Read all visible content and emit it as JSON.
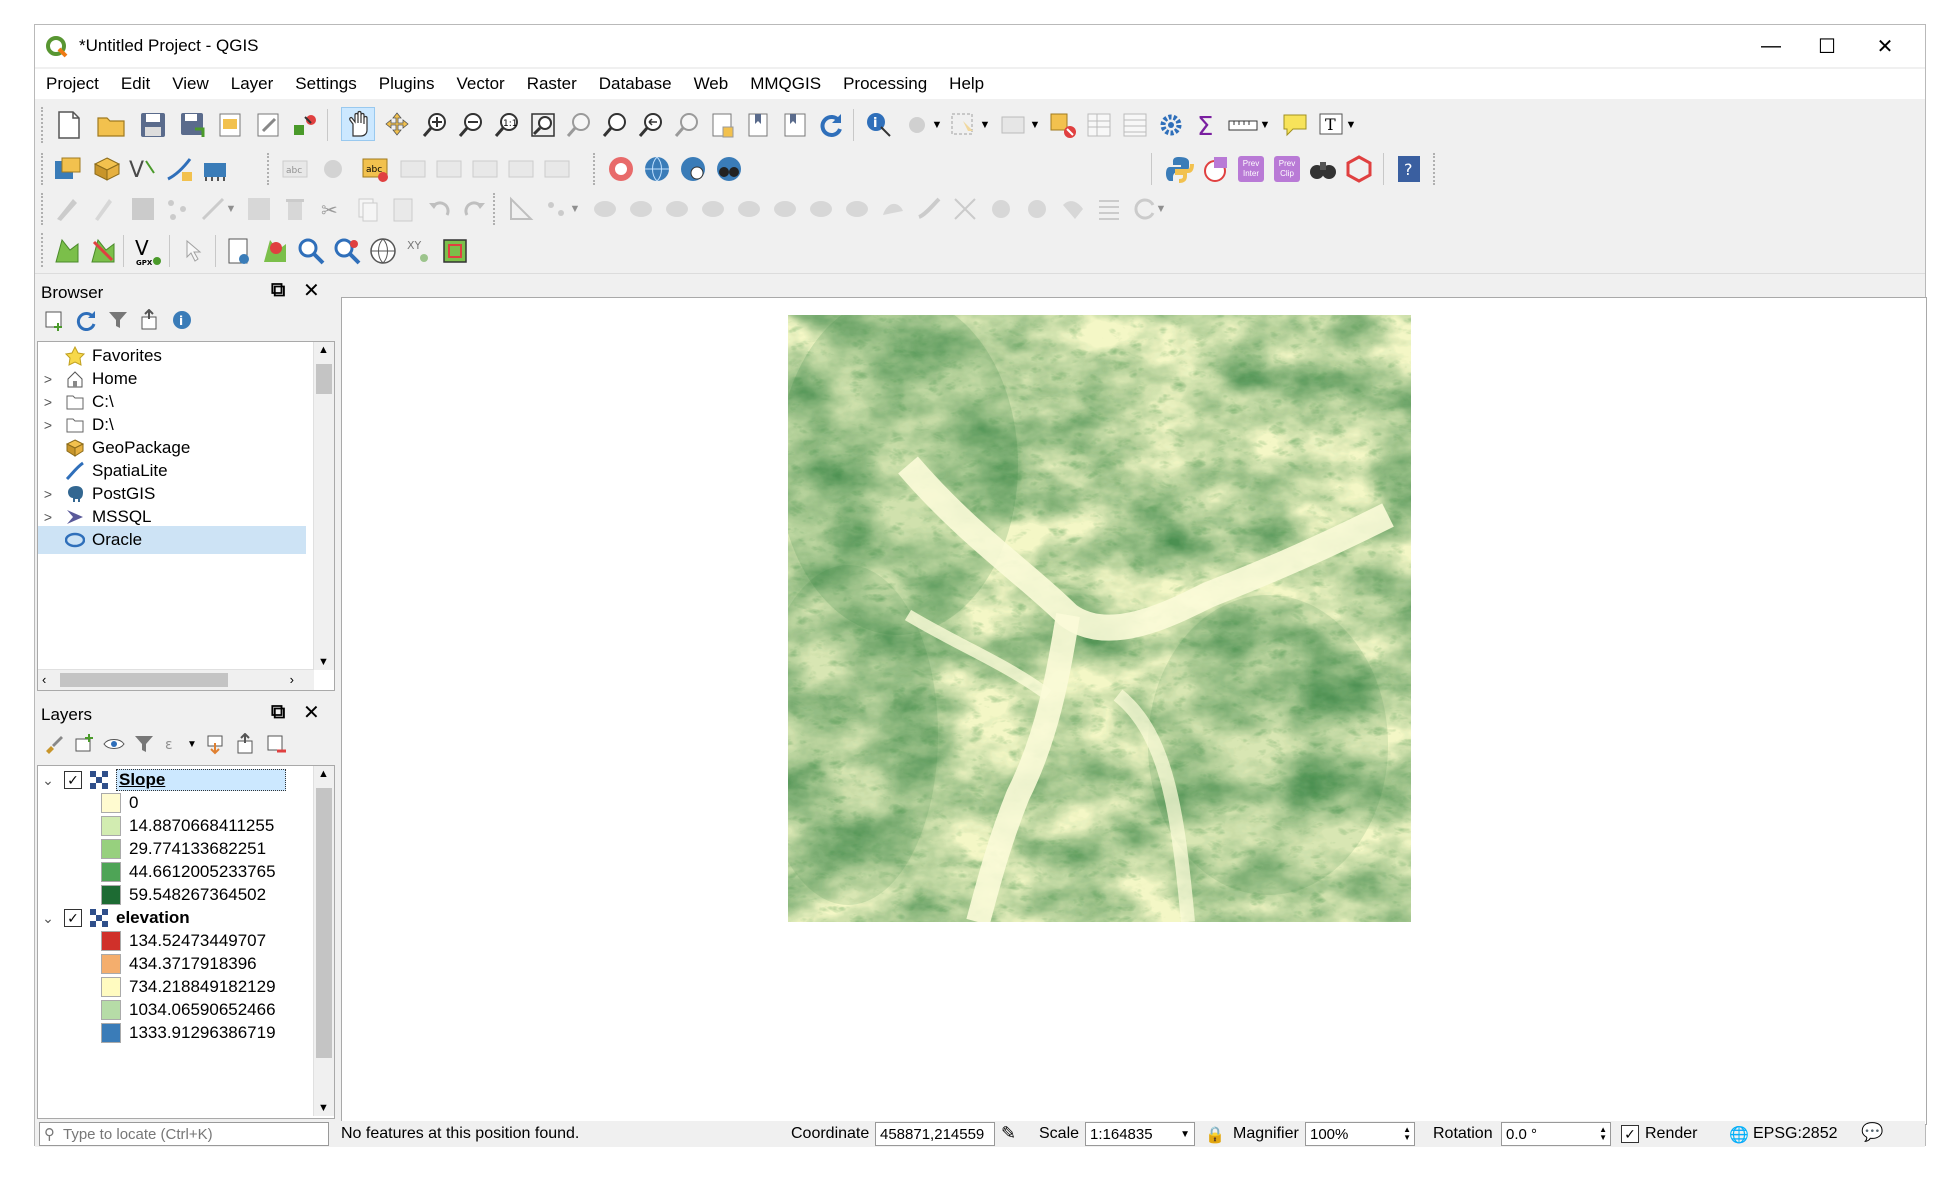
{
  "window": {
    "title": "*Untitled Project - QGIS",
    "controls": {
      "minimize": "—",
      "maximize": "☐",
      "close": "✕"
    }
  },
  "menubar": [
    "Project",
    "Edit",
    "View",
    "Layer",
    "Settings",
    "Plugins",
    "Vector",
    "Raster",
    "Database",
    "Web",
    "MMQGIS",
    "Processing",
    "Help"
  ],
  "toolbar_labels": {
    "prev_inter": "Prev Inter",
    "prev_clip": "Prev Clip",
    "gpx": "GPX"
  },
  "browser": {
    "title": "Browser",
    "items": [
      {
        "label": "Favorites",
        "icon": "star-icon",
        "expand": ""
      },
      {
        "label": "Home",
        "icon": "home-icon",
        "expand": ">"
      },
      {
        "label": "C:\\",
        "icon": "folder-icon",
        "expand": ">"
      },
      {
        "label": "D:\\",
        "icon": "folder-icon",
        "expand": ">"
      },
      {
        "label": "GeoPackage",
        "icon": "geopackage-icon",
        "expand": ""
      },
      {
        "label": "SpatiaLite",
        "icon": "feather-icon",
        "expand": ""
      },
      {
        "label": "PostGIS",
        "icon": "elephant-icon",
        "expand": ">"
      },
      {
        "label": "MSSQL",
        "icon": "mssql-icon",
        "expand": ">"
      },
      {
        "label": "Oracle",
        "icon": "database-icon",
        "expand": ""
      }
    ]
  },
  "layers": {
    "title": "Layers",
    "groups": [
      {
        "name": "Slope",
        "checked": true,
        "legend": [
          {
            "label": "0",
            "color": "#fffbd0"
          },
          {
            "label": "14.8870668411255",
            "color": "#d2ecb1"
          },
          {
            "label": "29.774133682251",
            "color": "#97d07e"
          },
          {
            "label": "44.6612005233765",
            "color": "#4ea456"
          },
          {
            "label": "59.548267364502",
            "color": "#1d6b33"
          }
        ]
      },
      {
        "name": "elevation",
        "checked": true,
        "legend": [
          {
            "label": "134.52473449707",
            "color": "#d0302a"
          },
          {
            "label": "434.3717918396",
            "color": "#f4ae6d"
          },
          {
            "label": "734.218849182129",
            "color": "#fffbc0"
          },
          {
            "label": "1034.06590652466",
            "color": "#b6dca7"
          },
          {
            "label": "1333.91296386719",
            "color": "#3a7cb8"
          }
        ]
      }
    ]
  },
  "statusbar": {
    "locate_placeholder": "Type to locate (Ctrl+K)",
    "message": "No features at this position found.",
    "coordinate_label": "Coordinate",
    "coordinate_value": "458871,214559",
    "scale_label": "Scale",
    "scale_value": "1:164835",
    "magnifier_label": "Magnifier",
    "magnifier_value": "100%",
    "rotation_label": "Rotation",
    "rotation_value": "0.0 °",
    "render_label": "Render",
    "render_checked": true,
    "crs": "EPSG:2852"
  },
  "colors": {
    "slope_low": "#fffbd0",
    "slope_high": "#1d6b33",
    "selection": "#cce8ff"
  }
}
